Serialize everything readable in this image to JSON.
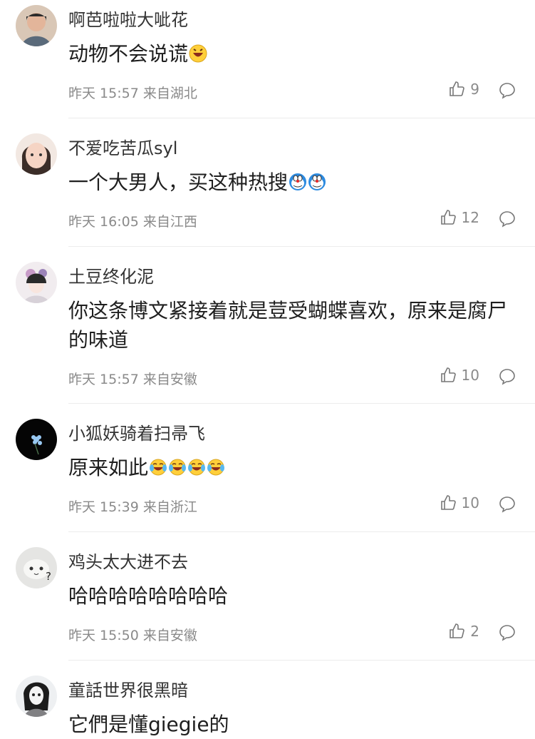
{
  "comments": [
    {
      "username": "啊芭啦啦大呲花",
      "text": "动物不会说谎",
      "emoji_count": 1,
      "emoji_type": "laughing",
      "meta": "昨天 15:57 来自湖北",
      "likes": "9"
    },
    {
      "username": "不爱吃苦瓜syl",
      "text": "一个大男人，买这种热搜",
      "emoji_count": 2,
      "emoji_type": "doraemon",
      "meta": "昨天 16:05 来自江西",
      "likes": "12"
    },
    {
      "username": "土豆终化泥",
      "text": "你这条博文紧接着就是荳受蝴蝶喜欢，原来是腐尸的味道",
      "emoji_count": 0,
      "emoji_type": "",
      "meta": "昨天 15:57 来自安徽",
      "likes": "10"
    },
    {
      "username": "小狐妖骑着扫帚飞",
      "text": "原来如此",
      "emoji_count": 4,
      "emoji_type": "tears-of-joy",
      "meta": "昨天 15:39 来自浙江",
      "likes": "10"
    },
    {
      "username": "鸡头太大进不去",
      "text": "哈哈哈哈哈哈哈哈",
      "emoji_count": 0,
      "emoji_type": "",
      "meta": "昨天 15:50 来自安徽",
      "likes": "2"
    },
    {
      "username": "童話世界很黑暗",
      "text": "它們是懂giegie的",
      "emoji_count": 0,
      "emoji_type": "",
      "meta": "",
      "likes": ""
    }
  ],
  "icons": {
    "like": "thumbs-up-icon",
    "reply": "comment-bubble-icon"
  },
  "colors": {
    "meta": "#8a8a8a",
    "text": "#1f1f1f",
    "divider": "#ececec"
  }
}
